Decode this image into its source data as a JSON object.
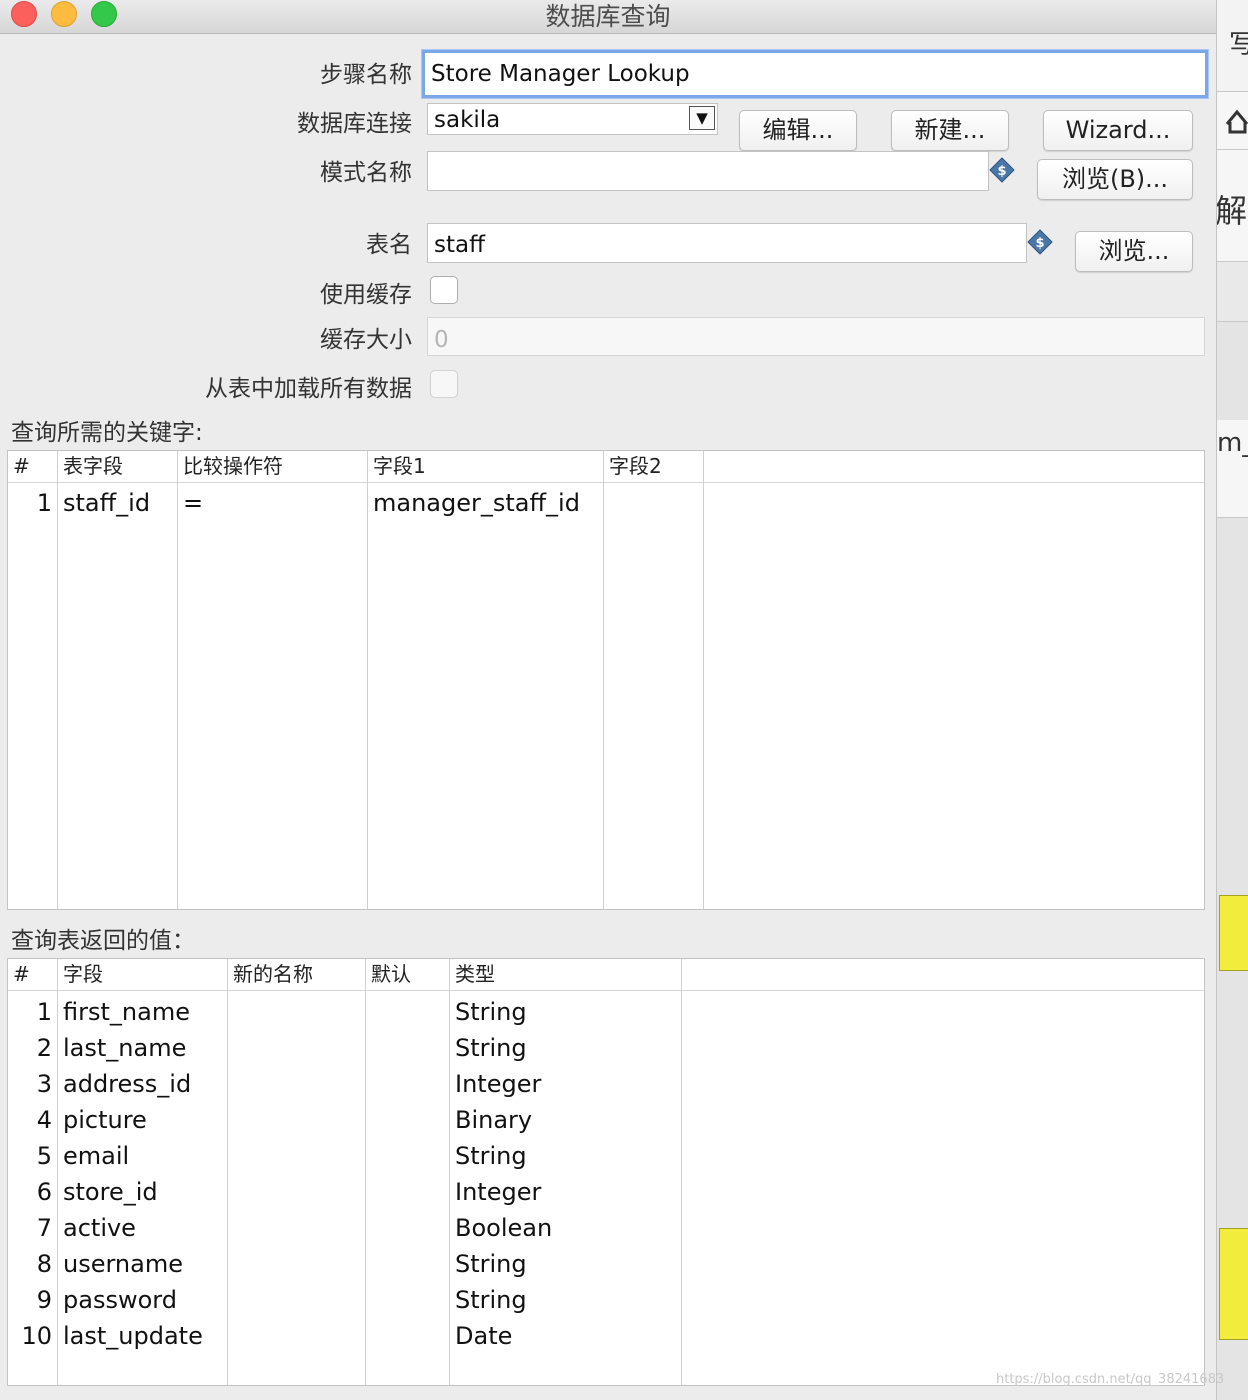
{
  "window": {
    "title": "数据库查询"
  },
  "form": {
    "step_name_label": "步骤名称",
    "step_name_value": "Store Manager Lookup",
    "connection_label": "数据库连接",
    "connection_value": "sakila",
    "edit_button": "编辑...",
    "new_button": "新建...",
    "wizard_button": "Wizard...",
    "schema_label": "模式名称",
    "schema_value": "",
    "browse_schema_button": "浏览(B)...",
    "table_label": "表名",
    "table_value": "staff",
    "browse_table_button": "浏览...",
    "use_cache_label": "使用缓存",
    "use_cache_checked": false,
    "cache_size_label": "缓存大小",
    "cache_size_value": "0",
    "load_all_label": "从表中加载所有数据",
    "load_all_checked": false
  },
  "keys_table": {
    "title": "查询所需的关键字:",
    "columns": [
      "#",
      "表字段",
      "比较操作符",
      "字段1",
      "字段2"
    ],
    "rows": [
      {
        "n": "1",
        "field": "staff_id",
        "op": "=",
        "f1": "manager_staff_id",
        "f2": ""
      }
    ]
  },
  "return_table": {
    "title": "查询表返回的值：",
    "columns": [
      "#",
      "字段",
      "新的名称",
      "默认",
      "类型"
    ],
    "rows": [
      {
        "n": "1",
        "field": "first_name",
        "rename": "",
        "default": "",
        "type": "String"
      },
      {
        "n": "2",
        "field": "last_name",
        "rename": "",
        "default": "",
        "type": "String"
      },
      {
        "n": "3",
        "field": "address_id",
        "rename": "",
        "default": "",
        "type": "Integer"
      },
      {
        "n": "4",
        "field": "picture",
        "rename": "",
        "default": "",
        "type": "Binary"
      },
      {
        "n": "5",
        "field": "email",
        "rename": "",
        "default": "",
        "type": "String"
      },
      {
        "n": "6",
        "field": "store_id",
        "rename": "",
        "default": "",
        "type": "Integer"
      },
      {
        "n": "7",
        "field": "active",
        "rename": "",
        "default": "",
        "type": "Boolean"
      },
      {
        "n": "8",
        "field": "username",
        "rename": "",
        "default": "",
        "type": "String"
      },
      {
        "n": "9",
        "field": "password",
        "rename": "",
        "default": "",
        "type": "String"
      },
      {
        "n": "10",
        "field": "last_update",
        "rename": "",
        "default": "",
        "type": "Date"
      }
    ]
  },
  "background_window": {
    "text_1": "写",
    "text_2": "解",
    "text_3": "m_"
  },
  "watermark": "https://blog.csdn.net/qq_38241683",
  "colors": {
    "focus_ring": "#7aa7e8",
    "variable_icon": "#4a76a8",
    "note_yellow": "#f2ec3c"
  }
}
